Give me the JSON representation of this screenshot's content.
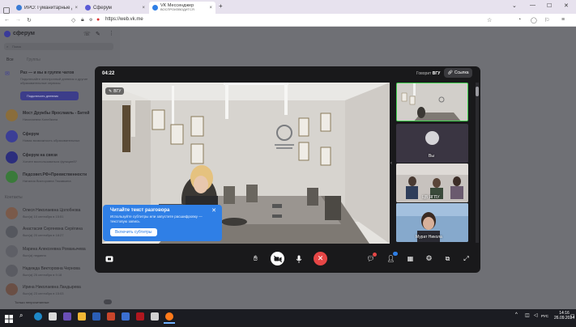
{
  "browser": {
    "tabs": [
      {
        "label": "ИРО: Гуманитарные дисциплины"
      },
      {
        "label": "Сферум"
      },
      {
        "label": "VK Мессенджер",
        "sublabel": "ВОСПРОИЗВОДИТСЯ"
      }
    ],
    "new_tab": "+",
    "url": "https://web.vk.me"
  },
  "sidebar": {
    "brand": "сферум",
    "search_placeholder": "Поиск",
    "filter_all": "Все",
    "filter_groups": "Группы",
    "promo_title": "Раз — и вы в группе чатов",
    "promo_desc": "Подключайте электронный дневник и другие образовательные сервисы",
    "promo_button": "Подключить дневник",
    "chats": [
      {
        "title": "Мост Дружбы Ярославль - Битей",
        "desc": "Николаевна Копейкина"
      },
      {
        "title": "Сферум",
        "desc": "Новая возможность образовательных"
      },
      {
        "title": "Сферум на связи",
        "desc": "Хотите воспользоваться функцией?"
      },
      {
        "title": "Педсовет.РФ+Преемственности",
        "desc": "Наталия Викторовна Тюкавкина"
      }
    ],
    "contacts_header": "Контакты",
    "contacts": [
      {
        "name": "Олеся Николаевна Цолобнова",
        "status": "был(а) 10 сентября в 15:51"
      },
      {
        "name": "Анастасия Сергеевна Серёгина",
        "status": "был(а) 20 сентября в 18:27"
      },
      {
        "name": "Марина Алексеевна Романычева",
        "status": "был(а) недавно"
      },
      {
        "name": "Надежда Викторовна Чернова",
        "status": "был(а) 25 сентября в 9:18"
      },
      {
        "name": "Ирина Николаевна Ландырева",
        "status": "был(а) 23 сентября в 15:03"
      }
    ],
    "footer": "Только непрочитанные"
  },
  "call": {
    "timer": "04:22",
    "speaking_prefix": "Говорит",
    "speaking_name": "ВГУ",
    "link_button": "Ссылка",
    "main_video_badge": "ВГУ",
    "popup": {
      "title": "Читайте текст разговора",
      "desc": "Используйте субтитры или запустите расшифровку — текстовую запись",
      "button": "Включить субтитры"
    },
    "tiles": [
      {
        "label": ""
      },
      {
        "label": "Вы"
      },
      {
        "label": "ЦВ ЯГПУ"
      },
      {
        "label": "Мурат Никола"
      }
    ]
  },
  "taskbar": {
    "time": "14:16",
    "date": "26.09.2024",
    "lang": "РУС"
  },
  "colors": {
    "accent": "#2f7fe6",
    "end_call": "#e64646",
    "active_tile_border": "#3fd04e"
  }
}
